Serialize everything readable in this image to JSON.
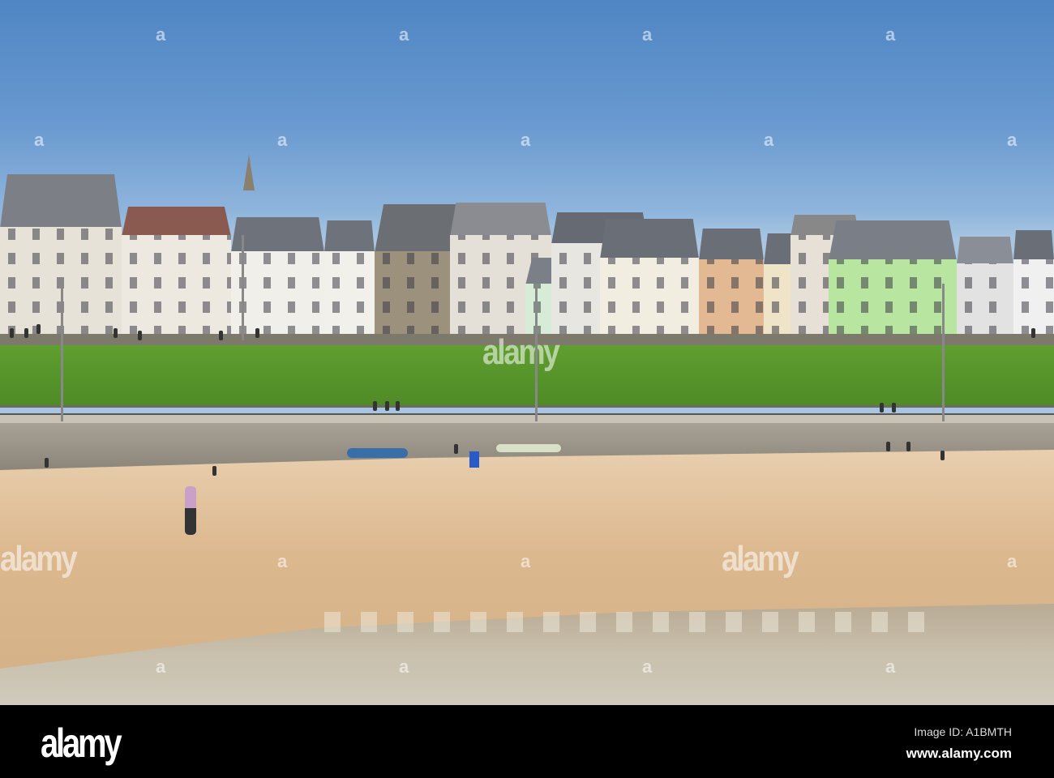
{
  "watermark": {
    "brand": "alamy",
    "small_mark": "a"
  },
  "footer": {
    "logo": "alamy",
    "image_id": "Image ID: A1BMTH",
    "url": "www.alamy.com"
  },
  "colors": {
    "sky": "#5a8ec8",
    "grass": "#5a9a2e",
    "sand": "#dcb88f",
    "water": "#c7bca8",
    "seawall": "#9a9185"
  }
}
